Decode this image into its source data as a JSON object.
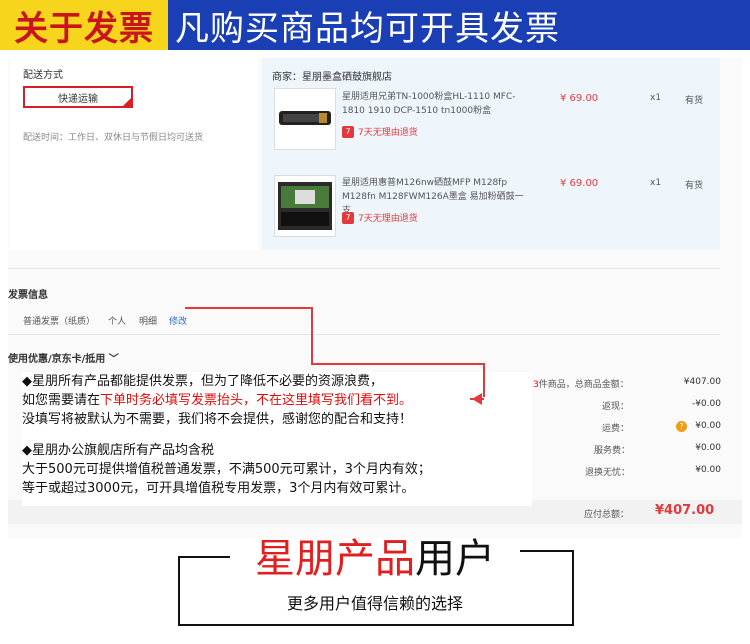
{
  "banner": {
    "left": "关于发票",
    "right": "凡购买商品均可开具发票"
  },
  "shipping": {
    "title": "配送方式",
    "method": "快递运输",
    "note": "配送时间：工作日、双休日与节假日均可送货"
  },
  "store": {
    "name": "商家：星朋墨盒硒鼓旗舰店",
    "products": [
      {
        "name": "星朋适用兄弟TN-1000粉盒HL-1110 MFC-1810 1910 DCP-1510 tn1000粉盒",
        "price": "¥ 69.00",
        "qty": "x1",
        "stock": "有货",
        "return": "7天无理由退货"
      },
      {
        "name": "星朋适用惠普M126nw硒鼓MFP M128fp M128fn M128FWM126A墨盒 易加粉硒鼓一支",
        "price": "¥ 69.00",
        "qty": "x1",
        "stock": "有货",
        "return": "7天无理由退货"
      }
    ]
  },
  "invoice": {
    "title": "发票信息",
    "options": [
      "普通发票（纸质）",
      "个人",
      "明细"
    ],
    "edit": "修改"
  },
  "discount": {
    "title": "使用优惠/京东卡/抵用 ﹀"
  },
  "summary": {
    "count_prefix": "3",
    "rows": [
      {
        "label": "件商品，总商品金额：",
        "value": "¥407.00"
      },
      {
        "label": "返现：",
        "value": "-¥0.00"
      },
      {
        "label": "运费：",
        "value": "¥0.00"
      },
      {
        "label": "服务费：",
        "value": "¥0.00"
      },
      {
        "label": "退换无忧：",
        "value": "¥0.00"
      }
    ],
    "fee_icon": "?",
    "total_label": "应付总额：",
    "total_value": "¥407.00"
  },
  "notice": {
    "line1": "◆星朋所有产品都能提供发票，但为了降低不必要的资源浪费，",
    "line2a": "如您需要请在",
    "line2b": "下单时务必填写发票抬头，不在这里填写我们看不到。",
    "line3": "没填写将被默认为不需要，我们将不会提供，感谢您的配合和支持！",
    "line4": "◆星朋办公旗舰店所有产品均含税",
    "line5": "大于500元可提供增值税普通发票，不满500元可累计，3个月内有效；",
    "line6": "等于或超过3000元，可开具增值税专用发票，3个月内有效可累计。"
  },
  "footer": {
    "slogan_red": "星朋产品",
    "slogan_black": "用户",
    "sub": "更多用户值得信赖的选择"
  },
  "colors": {
    "banner_blue": "#1a3fb4",
    "banner_yellow": "#f6d51c",
    "accent_red": "#e4393c"
  }
}
